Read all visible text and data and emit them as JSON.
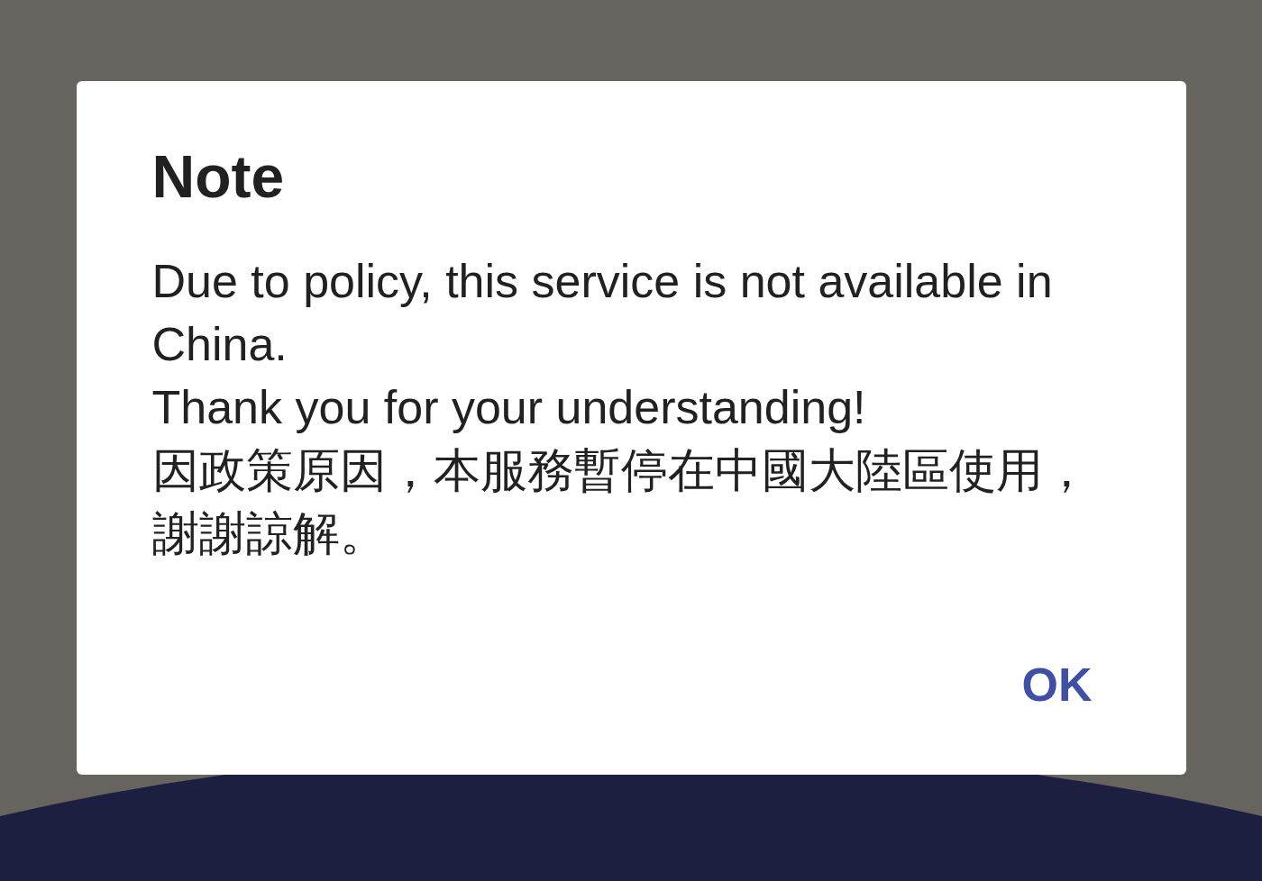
{
  "dialog": {
    "title": "Note",
    "paragraphs": [
      "Due to policy, this service is not available in China.",
      "Thank you for your understanding!",
      "因政策原因，本服務暫停在中國大陸區使用，謝謝諒解。"
    ],
    "buttons": [
      "OK"
    ]
  }
}
